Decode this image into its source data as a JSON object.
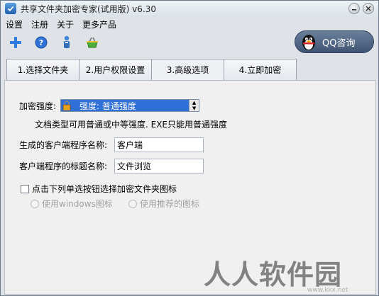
{
  "window": {
    "title": "共享文件夹加密专家(试用版) v6.30"
  },
  "menu": {
    "items": [
      "设置",
      "注册",
      "关于",
      "更多产品"
    ]
  },
  "toolbar": {
    "icons": [
      "add-icon",
      "help-icon",
      "user-icon",
      "basket-icon"
    ]
  },
  "qq": {
    "label": "QQ咨询"
  },
  "tabs": [
    {
      "label": "1.选择文件夹",
      "active": false
    },
    {
      "label": "2.用户权限设置",
      "active": false
    },
    {
      "label": "3.高级选项",
      "active": true
    },
    {
      "label": "4.立即加密",
      "active": false
    }
  ],
  "form": {
    "strength_label": "加密强度:",
    "strength_value": "强度: 普通强度",
    "strength_hint": "文档类型可用普通或中等强度. EXE只能用普通强度",
    "client_name_label": "生成的客户端程序名称:",
    "client_name_value": "客户端",
    "client_title_label": "客户端程序的标题名称:",
    "client_title_value": "文件浏览",
    "folder_icon_label": "点击下列单选按钮选择加密文件夹图标",
    "folder_icon_checked": false,
    "radio_windows_label": "使用windows图标",
    "radio_recommended_label": "使用推荐的图标"
  },
  "watermark": {
    "text": "人人软件园",
    "sub": "www.kkx.net"
  },
  "colors": {
    "select_bg": "#2f6fd8",
    "qq_bg": "#4a6080"
  }
}
